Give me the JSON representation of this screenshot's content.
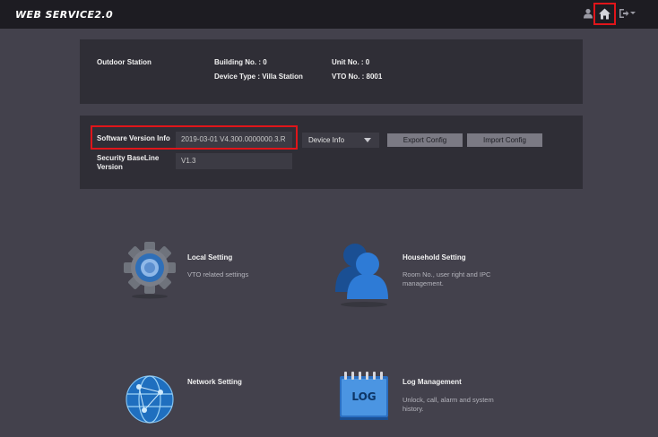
{
  "header": {
    "brand": "WEB SERVICE2.0",
    "icons": [
      "user-icon",
      "home-icon",
      "logout-icon"
    ]
  },
  "device": {
    "station_type": "Outdoor Station",
    "building_no": "Building No. : 0",
    "unit_no": "Unit No. : 0",
    "device_type": "Device Type : Villa Station",
    "vto_no": "VTO No. : 8001"
  },
  "version": {
    "software_label": "Software Version Info",
    "software_value": "2019-03-01 V4.300.0000000.3.R",
    "security_label_line1": "Security BaseLine",
    "security_label_line2": "Version",
    "security_value": "V1.3",
    "select_value": "Device Info",
    "export_label": "Export Config",
    "import_label": "Import Config"
  },
  "tiles": {
    "local": {
      "title": "Local Setting",
      "desc": "VTO related settings"
    },
    "household": {
      "title": "Household Setting",
      "desc_line1": "Room No., user right and IPC",
      "desc_line2": "management."
    },
    "network": {
      "title": "Network Setting"
    },
    "log": {
      "title": "Log Management",
      "icon_text": "LOG",
      "desc_line1": "Unlock, call, alarm and system",
      "desc_line2": "history."
    }
  },
  "colors": {
    "background": "#43414c",
    "topbar": "#1d1c22",
    "panel": "#2f2e36",
    "highlight": "#e0151a",
    "button": "#7b7a84"
  }
}
